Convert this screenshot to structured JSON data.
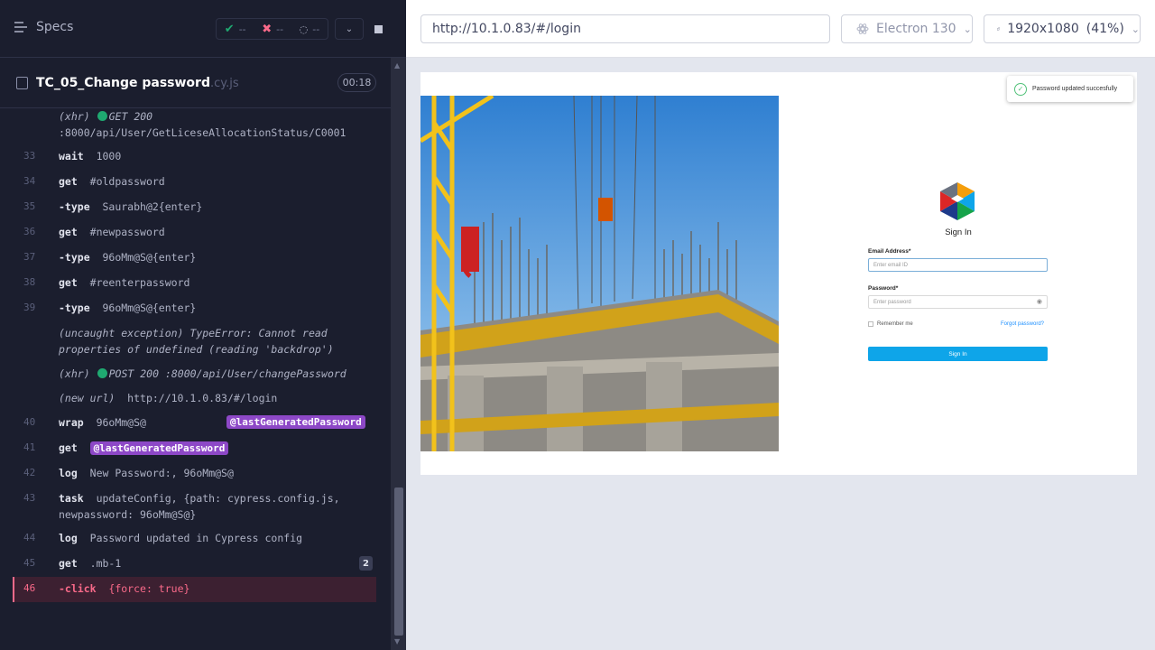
{
  "reporter": {
    "specs_label": "Specs",
    "passed": "--",
    "failed": "--",
    "pending": "--",
    "spec_name": "TC_05_Change password",
    "spec_ext": ".cy.js",
    "duration": "00:18"
  },
  "log": {
    "xhr1_label": "(xhr)",
    "xhr1_method": "GET 200",
    "xhr1_url": ":8000/api/User/GetLiceseAllocationStatus/C0001",
    "r33": {
      "num": "33",
      "cmd": "wait",
      "arg": "1000"
    },
    "r34": {
      "num": "34",
      "cmd": "get",
      "arg": "#oldpassword"
    },
    "r35": {
      "num": "35",
      "cmd": "-type",
      "arg": "Saurabh@2{enter}"
    },
    "r36": {
      "num": "36",
      "cmd": "get",
      "arg": "#newpassword"
    },
    "r37": {
      "num": "37",
      "cmd": "-type",
      "arg": "96oMm@S@{enter}"
    },
    "r38": {
      "num": "38",
      "cmd": "get",
      "arg": "#reenterpassword"
    },
    "r39": {
      "num": "39",
      "cmd": "-type",
      "arg": "96oMm@S@{enter}"
    },
    "exception_line1": "(uncaught exception)  TypeError: Cannot read",
    "exception_line2": "properties of undefined (reading 'backdrop')",
    "xhr2_label": "(xhr)",
    "xhr2_text": "POST 200 :8000/api/User/changePassword",
    "newurl_label": "(new url)",
    "newurl_value": "http://10.1.0.83/#/login",
    "r40": {
      "num": "40",
      "cmd": "wrap",
      "arg": "96oMm@S@",
      "alias": "@lastGeneratedPassword"
    },
    "r41": {
      "num": "41",
      "cmd": "get",
      "alias": "@lastGeneratedPassword"
    },
    "r42": {
      "num": "42",
      "cmd": "log",
      "arg": "New Password:, 96oMm@S@"
    },
    "r43": {
      "num": "43",
      "cmd": "task",
      "arg1": "updateConfig, {path: cypress.config.js,",
      "arg2": "newpassword: 96oMm@S@}"
    },
    "r44": {
      "num": "44",
      "cmd": "log",
      "arg": "Password updated in Cypress config"
    },
    "r45": {
      "num": "45",
      "cmd": "get",
      "arg": ".mb-1",
      "count": "2"
    },
    "r46": {
      "num": "46",
      "cmd": "-click",
      "arg": "{force: true}"
    }
  },
  "browser_bar": {
    "url": "http://10.1.0.83/#/login",
    "browser": "Electron 130",
    "viewport": "1920x1080",
    "scale": "(41%)"
  },
  "app": {
    "toast": "Password updated succesfully",
    "title": "Sign In",
    "email_label": "Email Address*",
    "email_placeholder": "Enter email ID",
    "password_label": "Password*",
    "password_placeholder": "Enter password",
    "remember": "Remember me",
    "forgot": "Forgot password?",
    "submit": "Sign In"
  },
  "colors": {
    "reporter_bg": "#1b1e2e",
    "pass": "#1fa971",
    "fail": "#fa6a8a",
    "alias": "#8d48c7",
    "signin_button": "#0ea5e9"
  }
}
